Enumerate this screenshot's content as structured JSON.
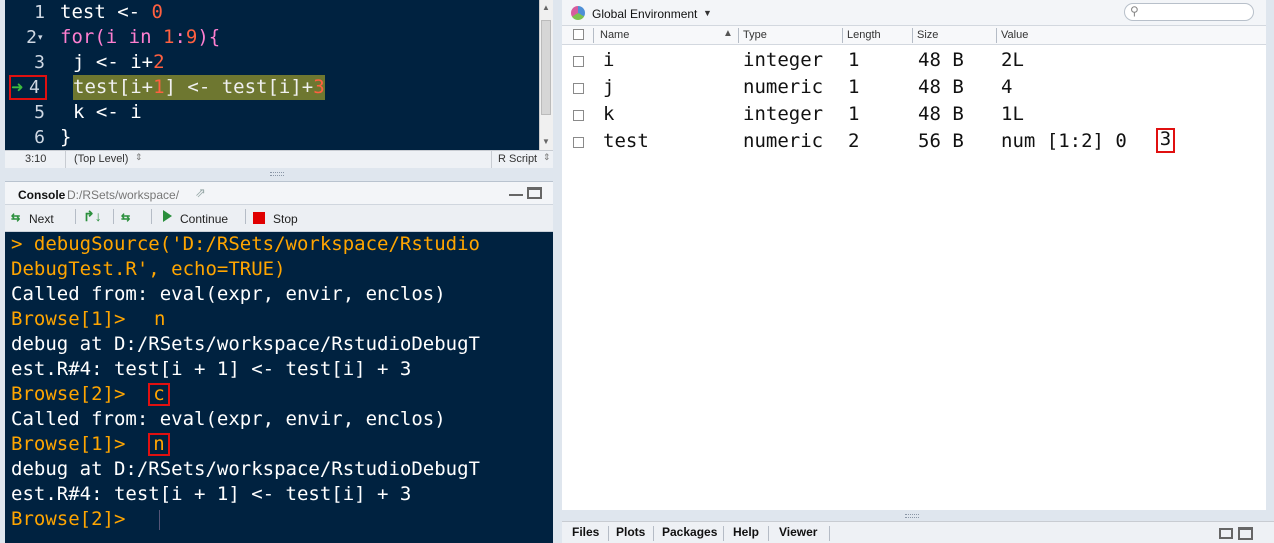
{
  "editor": {
    "lines": [
      {
        "n": "1",
        "text": "test <- 0"
      },
      {
        "n": "2",
        "text": "for(i in 1:9){"
      },
      {
        "n": "3",
        "text": "j <- i+2"
      },
      {
        "n": "4",
        "text": "test[i+1] <- test[i]+3"
      },
      {
        "n": "5",
        "text": "k <- i"
      },
      {
        "n": "6",
        "text": "}"
      }
    ],
    "status": {
      "position": "3:10",
      "scope": "(Top Level)",
      "filetype": "R Script"
    }
  },
  "console": {
    "title": "Console",
    "path": "D:/RSets/workspace/",
    "toolbar": {
      "next": "Next",
      "continue": "Continue",
      "stop": "Stop"
    },
    "lines": [
      "> debugSource('D:/RSets/workspace/Rstudio",
      "DebugTest.R', echo=TRUE)",
      "Called from: eval(expr, envir, enclos)",
      "Browse[1]> ",
      "n",
      "debug at D:/RSets/workspace/RstudioDebugT",
      "est.R#4: test[i + 1] <- test[i] + 3",
      "Browse[2]> ",
      "c",
      "Called from: eval(expr, envir, enclos)",
      "Browse[1]> ",
      "n",
      "debug at D:/RSets/workspace/RstudioDebugT",
      "est.R#4: test[i + 1] <- test[i] + 3",
      "Browse[2]> "
    ]
  },
  "environment": {
    "scope": "Global Environment",
    "columns": {
      "name": "Name",
      "type": "Type",
      "length": "Length",
      "size": "Size",
      "value": "Value"
    },
    "rows": [
      {
        "name": "i",
        "type": "integer",
        "length": "1",
        "size": "48 B",
        "value": "2L"
      },
      {
        "name": "j",
        "type": "numeric",
        "length": "1",
        "size": "48 B",
        "value": "4"
      },
      {
        "name": "k",
        "type": "integer",
        "length": "1",
        "size": "48 B",
        "value": "1L"
      },
      {
        "name": "test",
        "type": "numeric",
        "length": "2",
        "size": "56 B",
        "value": "num [1:2] 0",
        "value_hl": "3"
      }
    ]
  },
  "tabs": [
    "Files",
    "Plots",
    "Packages",
    "Help",
    "Viewer"
  ],
  "colors": {
    "editor_bg": "#002240",
    "prompt": "#ffa500",
    "highlight": "#6e7730",
    "marker": "#e01010"
  }
}
